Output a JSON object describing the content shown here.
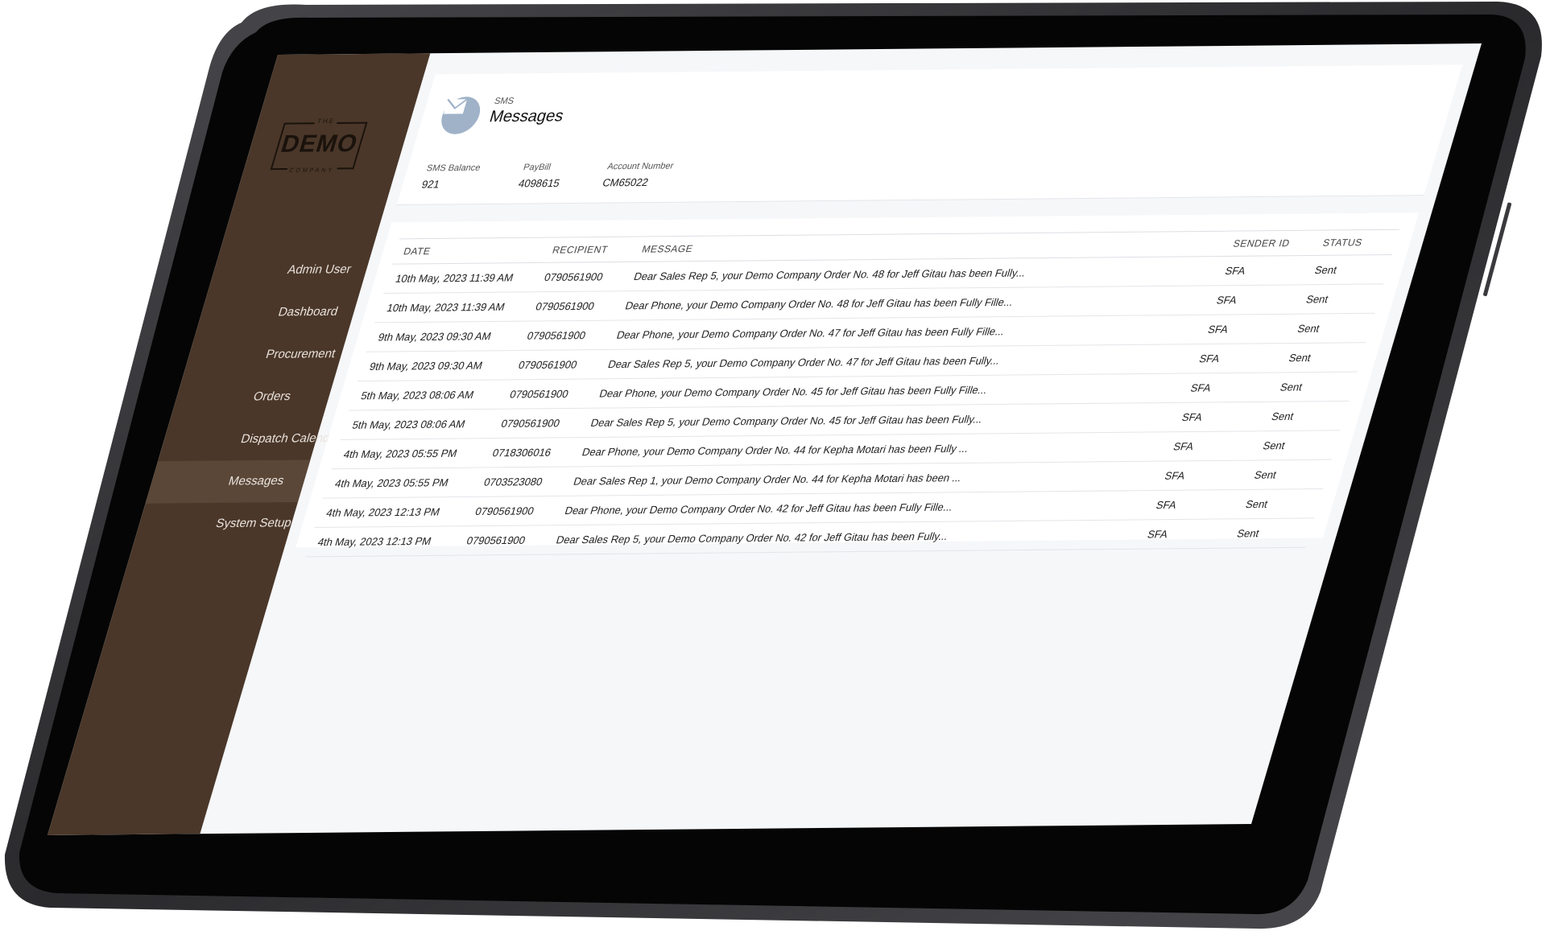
{
  "brand": {
    "logo_top": "THE",
    "logo_main": "DEMO",
    "logo_bottom": "COMPANY"
  },
  "sidebar": {
    "items": [
      {
        "label": "Admin User",
        "active": false
      },
      {
        "label": "Dashboard",
        "active": false
      },
      {
        "label": "Procurement",
        "active": false
      },
      {
        "label": "Orders",
        "active": false
      },
      {
        "label": "Dispatch Calendar",
        "active": false
      },
      {
        "label": "Messages",
        "active": true
      },
      {
        "label": "System Setup",
        "active": false
      }
    ]
  },
  "header": {
    "kicker": "SMS",
    "title": "Messages",
    "icon": "mail-icon"
  },
  "stats": [
    {
      "label": "SMS Balance",
      "value": "921"
    },
    {
      "label": "PayBill",
      "value": "4098615"
    },
    {
      "label": "Account Number",
      "value": "CM65022"
    }
  ],
  "table": {
    "columns": [
      "DATE",
      "RECIPIENT",
      "MESSAGE",
      "SENDER ID",
      "STATUS"
    ],
    "rows": [
      [
        "10th May, 2023 11:39 AM",
        "0790561900",
        "Dear Sales Rep 5, your Demo Company Order No. 48 for Jeff Gitau has been Fully...",
        "SFA",
        "Sent"
      ],
      [
        "10th May, 2023 11:39 AM",
        "0790561900",
        "Dear Phone, your Demo Company Order No. 48 for Jeff Gitau has been Fully Fille...",
        "SFA",
        "Sent"
      ],
      [
        "9th May, 2023 09:30 AM",
        "0790561900",
        "Dear Phone, your Demo Company Order No. 47 for Jeff Gitau has been Fully Fille...",
        "SFA",
        "Sent"
      ],
      [
        "9th May, 2023 09:30 AM",
        "0790561900",
        "Dear Sales Rep 5, your Demo Company Order No. 47 for Jeff Gitau has been Fully...",
        "SFA",
        "Sent"
      ],
      [
        "5th May, 2023 08:06 AM",
        "0790561900",
        "Dear Phone, your Demo Company Order No. 45 for Jeff Gitau has been Fully Fille...",
        "SFA",
        "Sent"
      ],
      [
        "5th May, 2023 08:06 AM",
        "0790561900",
        "Dear Sales Rep 5, your Demo Company Order No. 45 for Jeff Gitau has been Fully...",
        "SFA",
        "Sent"
      ],
      [
        "4th May, 2023 05:55 PM",
        "0718306016",
        "Dear Phone, your Demo Company Order No. 44 for Kepha Motari has been Fully ...",
        "SFA",
        "Sent"
      ],
      [
        "4th May, 2023 05:55 PM",
        "0703523080",
        "Dear Sales Rep 1, your Demo Company Order No. 44 for Kepha Motari has been ...",
        "SFA",
        "Sent"
      ],
      [
        "4th May, 2023 12:13 PM",
        "0790561900",
        "Dear Phone, your Demo Company Order No. 42 for Jeff Gitau has been Fully Fille...",
        "SFA",
        "Sent"
      ],
      [
        "4th May, 2023 12:13 PM",
        "0790561900",
        "Dear Sales Rep 5, your Demo Company Order No. 42 for Jeff Gitau has been Fully...",
        "SFA",
        "Sent"
      ]
    ]
  },
  "colors": {
    "sidebar_bg": "#4a3729",
    "sidebar_active": "#5a4738",
    "device_frame": "#1b1b1d",
    "mail_badge": "#9fb2c8"
  }
}
